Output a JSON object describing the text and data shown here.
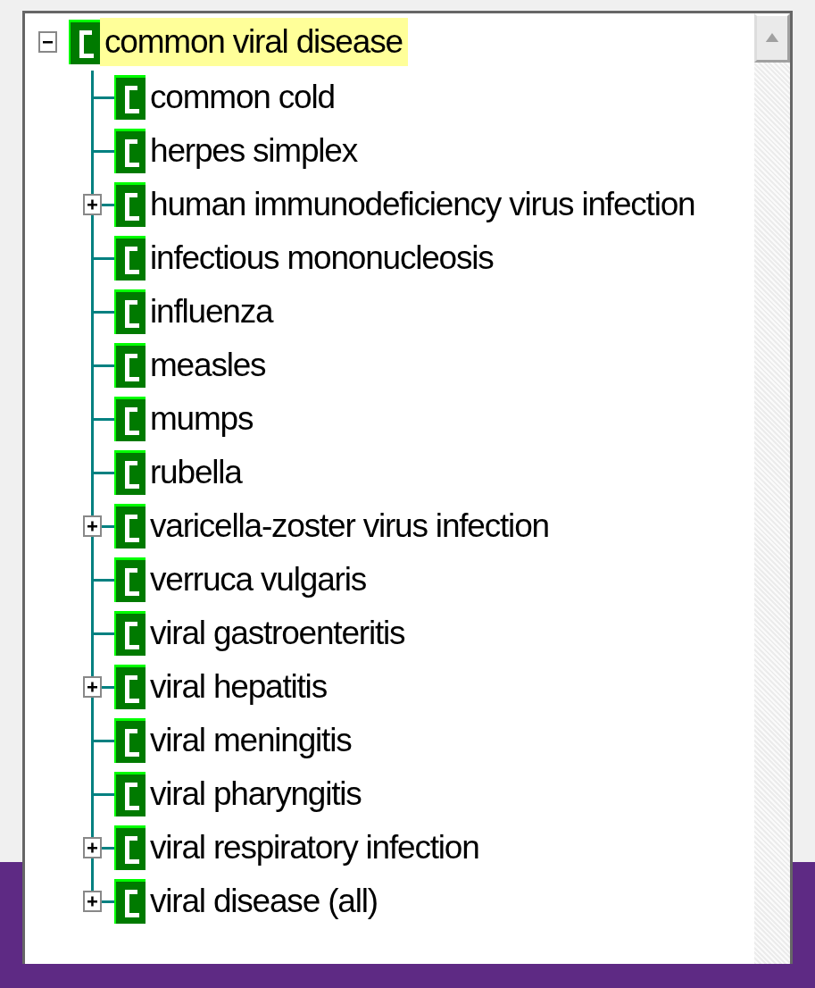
{
  "tree": {
    "label": "common viral disease",
    "selected": true,
    "expanded": true,
    "children": [
      {
        "label": "common cold",
        "selected": false
      },
      {
        "label": "herpes simplex",
        "selected": false
      },
      {
        "label": "human immunodeficiency virus infection",
        "selected": false,
        "expanded": false
      },
      {
        "label": "infectious mononucleosis",
        "selected": false
      },
      {
        "label": "influenza",
        "selected": false
      },
      {
        "label": "measles",
        "selected": false
      },
      {
        "label": "mumps",
        "selected": false
      },
      {
        "label": "rubella",
        "selected": false
      },
      {
        "label": "varicella-zoster virus infection",
        "selected": false,
        "expanded": false
      },
      {
        "label": "verruca vulgaris",
        "selected": false
      },
      {
        "label": "viral gastroenteritis",
        "selected": false
      },
      {
        "label": "viral hepatitis",
        "selected": false,
        "expanded": false
      },
      {
        "label": "viral meningitis",
        "selected": false
      },
      {
        "label": "viral pharyngitis",
        "selected": false
      },
      {
        "label": "viral respiratory infection",
        "selected": false,
        "expanded": false
      },
      {
        "label": "viral disease (all)",
        "selected": false,
        "expanded": false
      }
    ]
  }
}
